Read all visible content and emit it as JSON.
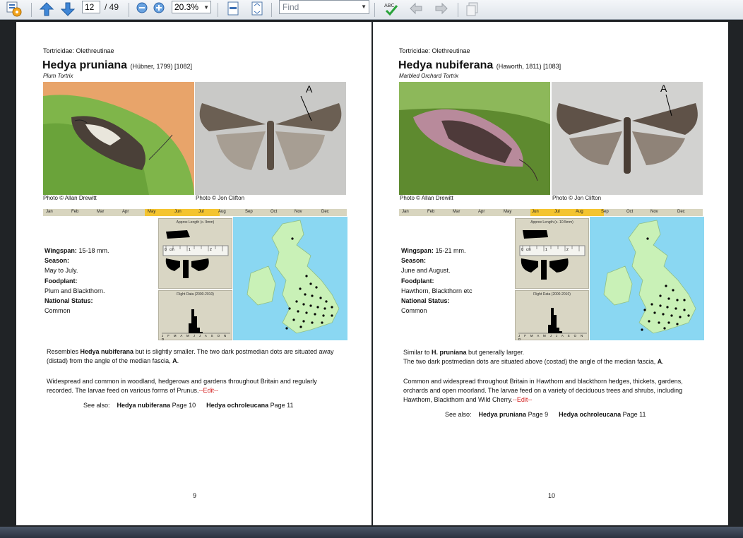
{
  "toolbar": {
    "page_current": "12",
    "page_total": "/ 49",
    "zoom": "20.3%",
    "find_placeholder": "Find"
  },
  "months": [
    "Jan",
    "Feb",
    "Mar",
    "Apr",
    "May",
    "Jun",
    "Jul",
    "Aug",
    "Sep",
    "Oct",
    "Nov",
    "Dec"
  ],
  "pages": [
    {
      "family": "Tortricidae: Olethreutinae",
      "species": "Hedya pruniana",
      "authority": "(Hübner, 1799) [1082]",
      "common_name": "Plum Tortrix",
      "annotation_letter": "A",
      "credit_left": "Photo © Allan Drewitt",
      "credit_right": "Photo © Jon Clifton",
      "flight_months": [
        "May",
        "Jun",
        "Jul"
      ],
      "length_title": "Approx Length (c. 9mm)",
      "flight_title": "Flight Data (2000-2010)",
      "ruler_labels": [
        "0",
        "cm",
        "1",
        "2"
      ],
      "flight_axis": "J F M A M J J A S O N D",
      "wingspan_label": "Wingspan:",
      "wingspan_value": "15-18 mm.",
      "season_label": "Season:",
      "season_value": "May to July.",
      "foodplant_label": "Foodplant:",
      "foodplant_value": "Plum and Blackthorn.",
      "status_label": "National Status:",
      "status_value": "Common",
      "para1_a": "Resembles ",
      "para1_bold": "Hedya nubiferana",
      "para1_b": " but is slightly smaller. The two dark postmedian dots are situated away (distad) from the angle of the median fascia, ",
      "para1_end": "A",
      "para1_dot": ".",
      "para2": "Widespread and common in woodland, hedgerows and gardens throughout Britain and regularly recorded. The larvae feed on various forms of Prunus.",
      "edit": "--Edit--",
      "see_also": "See also:",
      "see1_name": "Hedya nubiferana",
      "see1_page": " Page 10",
      "see2_name": "Hedya ochroleucana",
      "see2_page": " Page 11",
      "page_number": "9"
    },
    {
      "family": "Tortricidae: Olethreutinae",
      "species": "Hedya nubiferana",
      "authority": "(Haworth, 1811) [1083]",
      "common_name": "Marbled Orchard Tortrix",
      "annotation_letter": "A",
      "credit_left": "Photo © Allan Drewitt",
      "credit_right": "Photo © Jon Clifton",
      "flight_months": [
        "Jun",
        "Jul",
        "Aug"
      ],
      "length_title": "Approx Length (c. 10.5mm)",
      "flight_title": "Flight Data (2000-2010)",
      "ruler_labels": [
        "0",
        "cm",
        "1",
        "2"
      ],
      "flight_axis": "J F M A M J J A S O N D",
      "wingspan_label": "Wingspan:",
      "wingspan_value": "15-21 mm.",
      "season_label": "Season:",
      "season_value": "June and August.",
      "foodplant_label": "Foodplant:",
      "foodplant_value": "Hawthorn, Blackthorn etc",
      "status_label": "National Status:",
      "status_value": "Common",
      "para1_a": "Similar to ",
      "para1_bold": "H. pruniana",
      "para1_b": " but generally larger.",
      "para1_line2": "The two dark postmedian dots are situated above (costad) the angle of the median fascia, ",
      "para1_end": "A",
      "para1_dot": ".",
      "para2": "Common and widespread throughout Britain in Hawthorn and blackthorn hedges, thickets, gardens, orchards and open moorland. The larvae feed on a variety of deciduous trees and shrubs, including Hawthorn, Blackthorn and Wild Cherry.",
      "edit": "--Edit--",
      "see_also": "See also:",
      "see1_name": "Hedya pruniana",
      "see1_page": " Page 9",
      "see2_name": "Hedya ochroleucana",
      "see2_page": " Page 11",
      "page_number": "10"
    }
  ],
  "icons": [
    "app-gear-icon",
    "arrow-up-icon",
    "arrow-down-icon",
    "zoom-out-icon",
    "zoom-in-icon",
    "fit-page-icon",
    "fit-width-icon",
    "spellcheck-icon",
    "undo-icon",
    "redo-icon",
    "copy-icon"
  ],
  "colors": {
    "highlight_month": "#f4c430",
    "map_sea": "#8ad7f2",
    "map_land": "#c9f1b7",
    "edit": "#d42020"
  }
}
